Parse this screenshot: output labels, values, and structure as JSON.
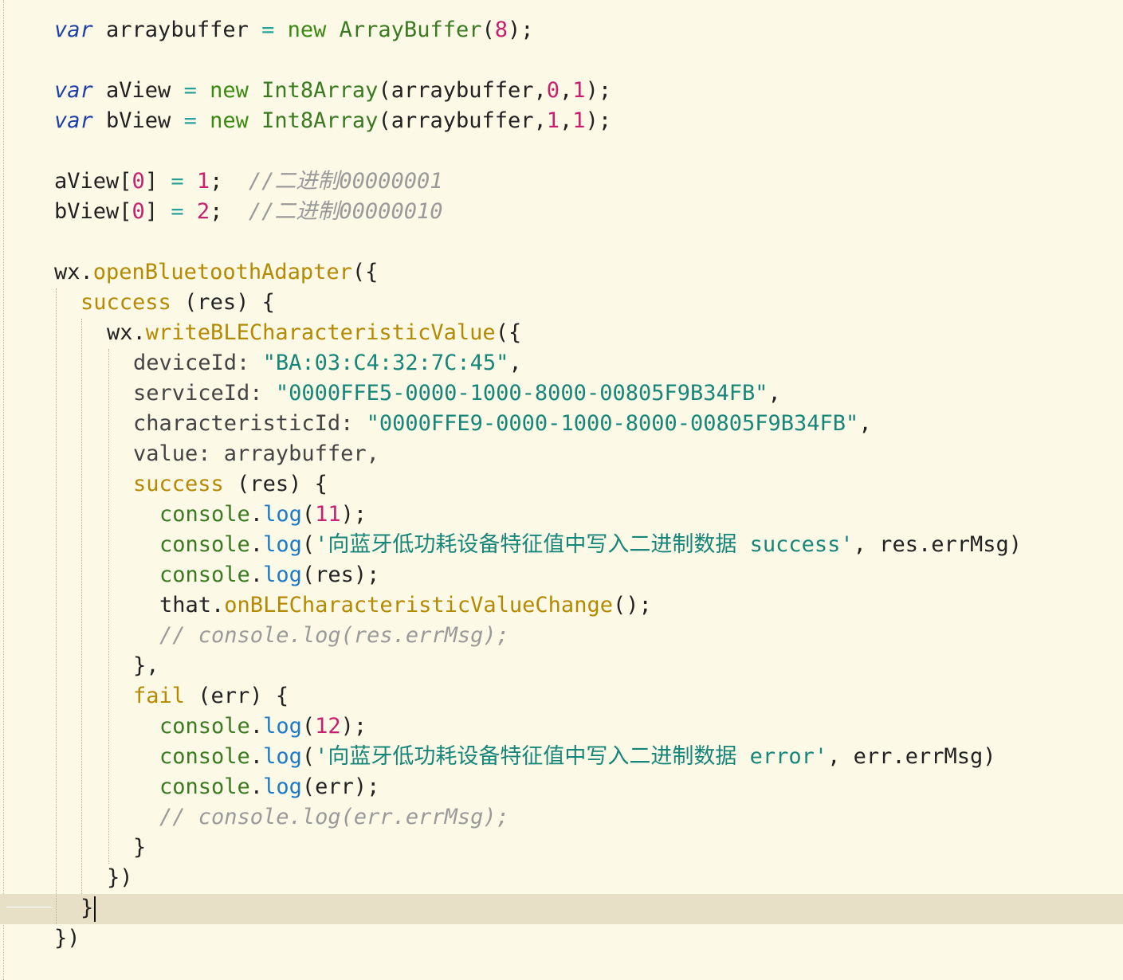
{
  "code": {
    "l1": {
      "kw": "var",
      "name": " arraybuffer ",
      "eq": "=",
      "new": " new ",
      "cls": "ArrayBuffer",
      "p1": "(",
      "n": "8",
      "p2": ");"
    },
    "l3": {
      "kw": "var",
      "name": " aView ",
      "eq": "=",
      "new": " new ",
      "cls": "Int8Array",
      "a1": "(arraybuffer,",
      "n1": "0",
      "c": ",",
      "n2": "1",
      "p2": ");"
    },
    "l4": {
      "kw": "var",
      "name": " bView ",
      "eq": "=",
      "new": " new ",
      "cls": "Int8Array",
      "a1": "(arraybuffer,",
      "n1": "1",
      "c": ",",
      "n2": "1",
      "p2": ");"
    },
    "l6": {
      "a": "aView[",
      "i": "0",
      "b": "] ",
      "eq": "=",
      "sp": " ",
      "n": "1",
      "semi": ";  ",
      "com": "//二进制00000001"
    },
    "l7": {
      "a": "bView[",
      "i": "0",
      "b": "] ",
      "eq": "=",
      "sp": " ",
      "n": "2",
      "semi": ";  ",
      "com": "//二进制00000010"
    },
    "l9": {
      "obj": "wx",
      "dot": ".",
      "fn": "openBluetoothAdapter",
      "rest": "({"
    },
    "l10": {
      "fn": "success",
      "rest": " (res) {"
    },
    "l11": {
      "obj": "wx",
      "dot": ".",
      "fn": "writeBLECharacteristicValue",
      "rest": "({"
    },
    "l12": {
      "key": "deviceId: ",
      "str": "\"BA:03:C4:32:7C:45\"",
      "end": ","
    },
    "l13": {
      "key": "serviceId: ",
      "str": "\"0000FFE5-0000-1000-8000-00805F9B34FB\"",
      "end": ","
    },
    "l14": {
      "key": "characteristicId: ",
      "str": "\"0000FFE9-0000-1000-8000-00805F9B34FB\"",
      "end": ","
    },
    "l15": {
      "key": "value: arraybuffer,"
    },
    "l16": {
      "fn": "success",
      "rest": " (res) {"
    },
    "l17": {
      "con": "console",
      "dot": ".",
      "meth": "log",
      "p": "(",
      "n": "11",
      "end": ");"
    },
    "l18": {
      "con": "console",
      "dot": ".",
      "meth": "log",
      "p": "(",
      "str": "'向蓝牙低功耗设备特征值中写入二进制数据 success'",
      "end": ", res.errMsg)"
    },
    "l19": {
      "con": "console",
      "dot": ".",
      "meth": "log",
      "end": "(res);"
    },
    "l20": {
      "obj": "that",
      "dot": ".",
      "fn": "onBLECharacteristicValueChange",
      "end": "();"
    },
    "l21": {
      "com": "// console.log(res.errMsg);"
    },
    "l22": {
      "text": "},"
    },
    "l23": {
      "fn": "fail",
      "rest": " (err) {"
    },
    "l24": {
      "con": "console",
      "dot": ".",
      "meth": "log",
      "p": "(",
      "n": "12",
      "end": ");"
    },
    "l25": {
      "con": "console",
      "dot": ".",
      "meth": "log",
      "p": "(",
      "str": "'向蓝牙低功耗设备特征值中写入二进制数据 error'",
      "end": ", err.errMsg)"
    },
    "l26": {
      "con": "console",
      "dot": ".",
      "meth": "log",
      "end": "(err);"
    },
    "l27": {
      "com": "// console.log(err.errMsg);"
    },
    "l28": {
      "text": "}"
    },
    "l29": {
      "text": "})"
    },
    "l30": {
      "text": "}"
    },
    "l31": {
      "text": "})"
    }
  },
  "colors": {
    "background": "#fdf9e7",
    "current_line": "#e8e0c6"
  }
}
